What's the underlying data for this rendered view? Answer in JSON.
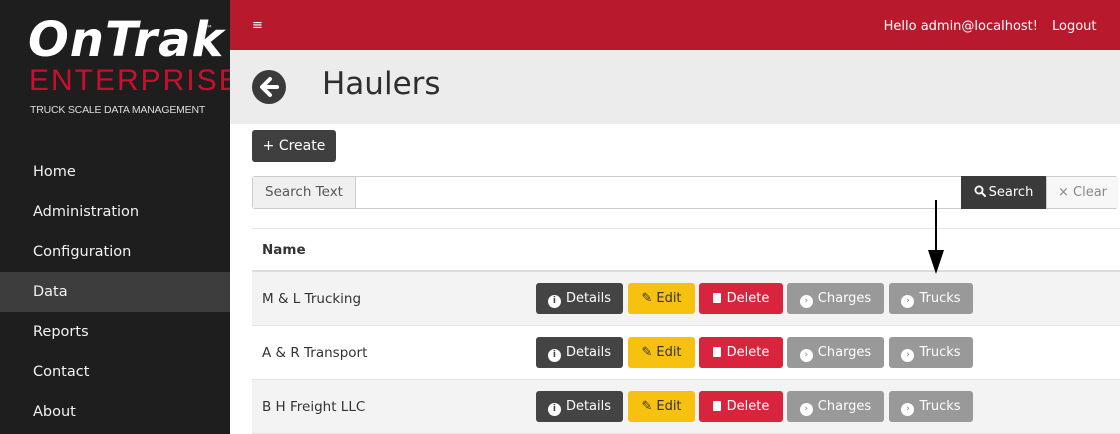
{
  "brand": {
    "name": "OnTrak",
    "tm": "™",
    "edition": "ENTERPRISE",
    "tagline": "TRUCK SCALE DATA MANAGEMENT"
  },
  "sidebar": {
    "items": [
      {
        "label": "Home"
      },
      {
        "label": "Administration"
      },
      {
        "label": "Configuration"
      },
      {
        "label": "Data",
        "active": true
      },
      {
        "label": "Reports"
      },
      {
        "label": "Contact"
      },
      {
        "label": "About"
      }
    ]
  },
  "topbar": {
    "menu_icon": "≡",
    "greeting": "Hello admin@localhost!",
    "logout": "Logout"
  },
  "header": {
    "title": "Haulers",
    "back_icon": "arrow-left-circle-icon"
  },
  "toolbar": {
    "create_label": "+ Create"
  },
  "search": {
    "label": "Search Text",
    "value": "",
    "search_label": "Search",
    "clear_label": "× Clear"
  },
  "table": {
    "columns": [
      "Name"
    ],
    "row_actions": {
      "details": "Details",
      "edit": "Edit",
      "delete": "Delete",
      "charges": "Charges",
      "trucks": "Trucks"
    },
    "rows": [
      {
        "name": "M & L Trucking"
      },
      {
        "name": "A & R Transport"
      },
      {
        "name": "B H Freight LLC"
      }
    ]
  },
  "colors": {
    "topbar": "#b8192c",
    "sidebar": "#1e1e1e",
    "edit": "#f7c110",
    "delete": "#d8243c",
    "neutral": "#999999"
  }
}
